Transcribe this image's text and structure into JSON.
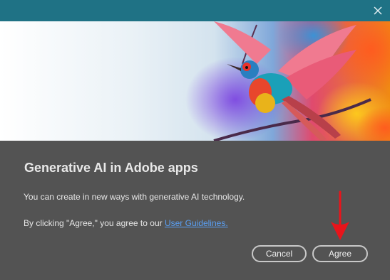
{
  "window": {
    "close_icon": "close-icon"
  },
  "banner": {
    "image": "colorful-bird-artwork"
  },
  "dialog": {
    "title": "Generative AI in Adobe apps",
    "description": "You can create in new ways with generative AI technology.",
    "agreement_prefix": "By clicking \"Agree,\" you agree to our ",
    "agreement_link": "User Guidelines."
  },
  "buttons": {
    "cancel_label": "Cancel",
    "agree_label": "Agree"
  },
  "annotation": {
    "arrow_color": "#e8141b"
  },
  "colors": {
    "titlebar": "#1f7285",
    "dialog_bg": "#535353",
    "link": "#5aa0f5"
  }
}
